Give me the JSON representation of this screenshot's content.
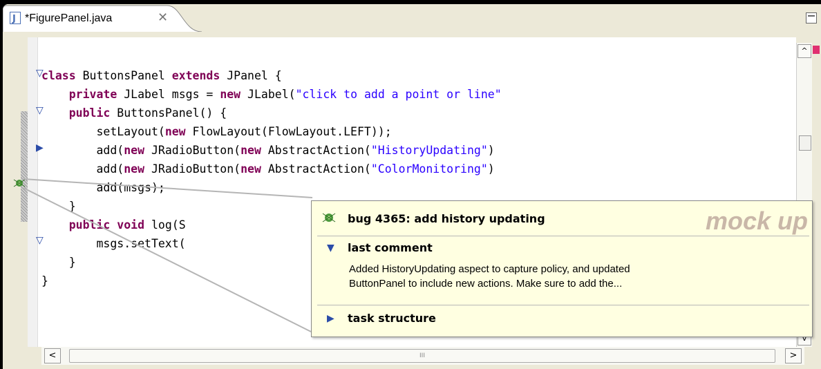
{
  "tab": {
    "title": "*FigurePanel.java",
    "close_glyph": "✕"
  },
  "code": {
    "lines": [
      [
        "",
        {
          "k": "class"
        },
        " ButtonsPanel ",
        {
          "k": "extends"
        },
        " JPanel {"
      ],
      [
        "    ",
        {
          "k": "private"
        },
        " JLabel msgs = ",
        {
          "k": "new"
        },
        " JLabel(",
        {
          "s": "\"click to add a point or line\""
        }
      ],
      [
        "    ",
        {
          "k": "public"
        },
        " ButtonsPanel() {"
      ],
      [
        "        setLayout(",
        {
          "k": "new"
        },
        " FlowLayout(FlowLayout.LEFT));"
      ],
      [
        "        add(",
        {
          "k": "new"
        },
        " JRadioButton(",
        {
          "k": "new"
        },
        " AbstractAction(",
        {
          "s": "\"HistoryUpdating\""
        },
        ")"
      ],
      [
        "        add(",
        {
          "k": "new"
        },
        " JRadioButton(",
        {
          "k": "new"
        },
        " AbstractAction(",
        {
          "s": "\"ColorMonitoring\""
        },
        ")"
      ],
      [
        "        add(msgs);"
      ],
      [
        "    }"
      ],
      [
        "    ",
        {
          "k": "public"
        },
        " ",
        {
          "k": "void"
        },
        " log(S"
      ],
      [
        "        msgs.setText("
      ],
      [
        "    }"
      ],
      [
        "}"
      ]
    ]
  },
  "popup": {
    "bug_title": "bug 4365: add history updating",
    "watermark": "mock up",
    "last_comment_label": "last comment",
    "comment_line1": "Added HistoryUpdating aspect to capture policy, and updated",
    "comment_line2": "ButtonPanel to include new actions.  Make sure to add the...",
    "task_structure_label": "task structure"
  },
  "scroll": {
    "left_arrow": "<",
    "right_arrow": ">",
    "up_arrow": "^",
    "down_arrow": "v",
    "grip": "III"
  },
  "colors": {
    "keyword": "#7f0055",
    "string": "#2a00ff",
    "tooltip_bg": "#ffffe1",
    "marker": "#e03070"
  }
}
